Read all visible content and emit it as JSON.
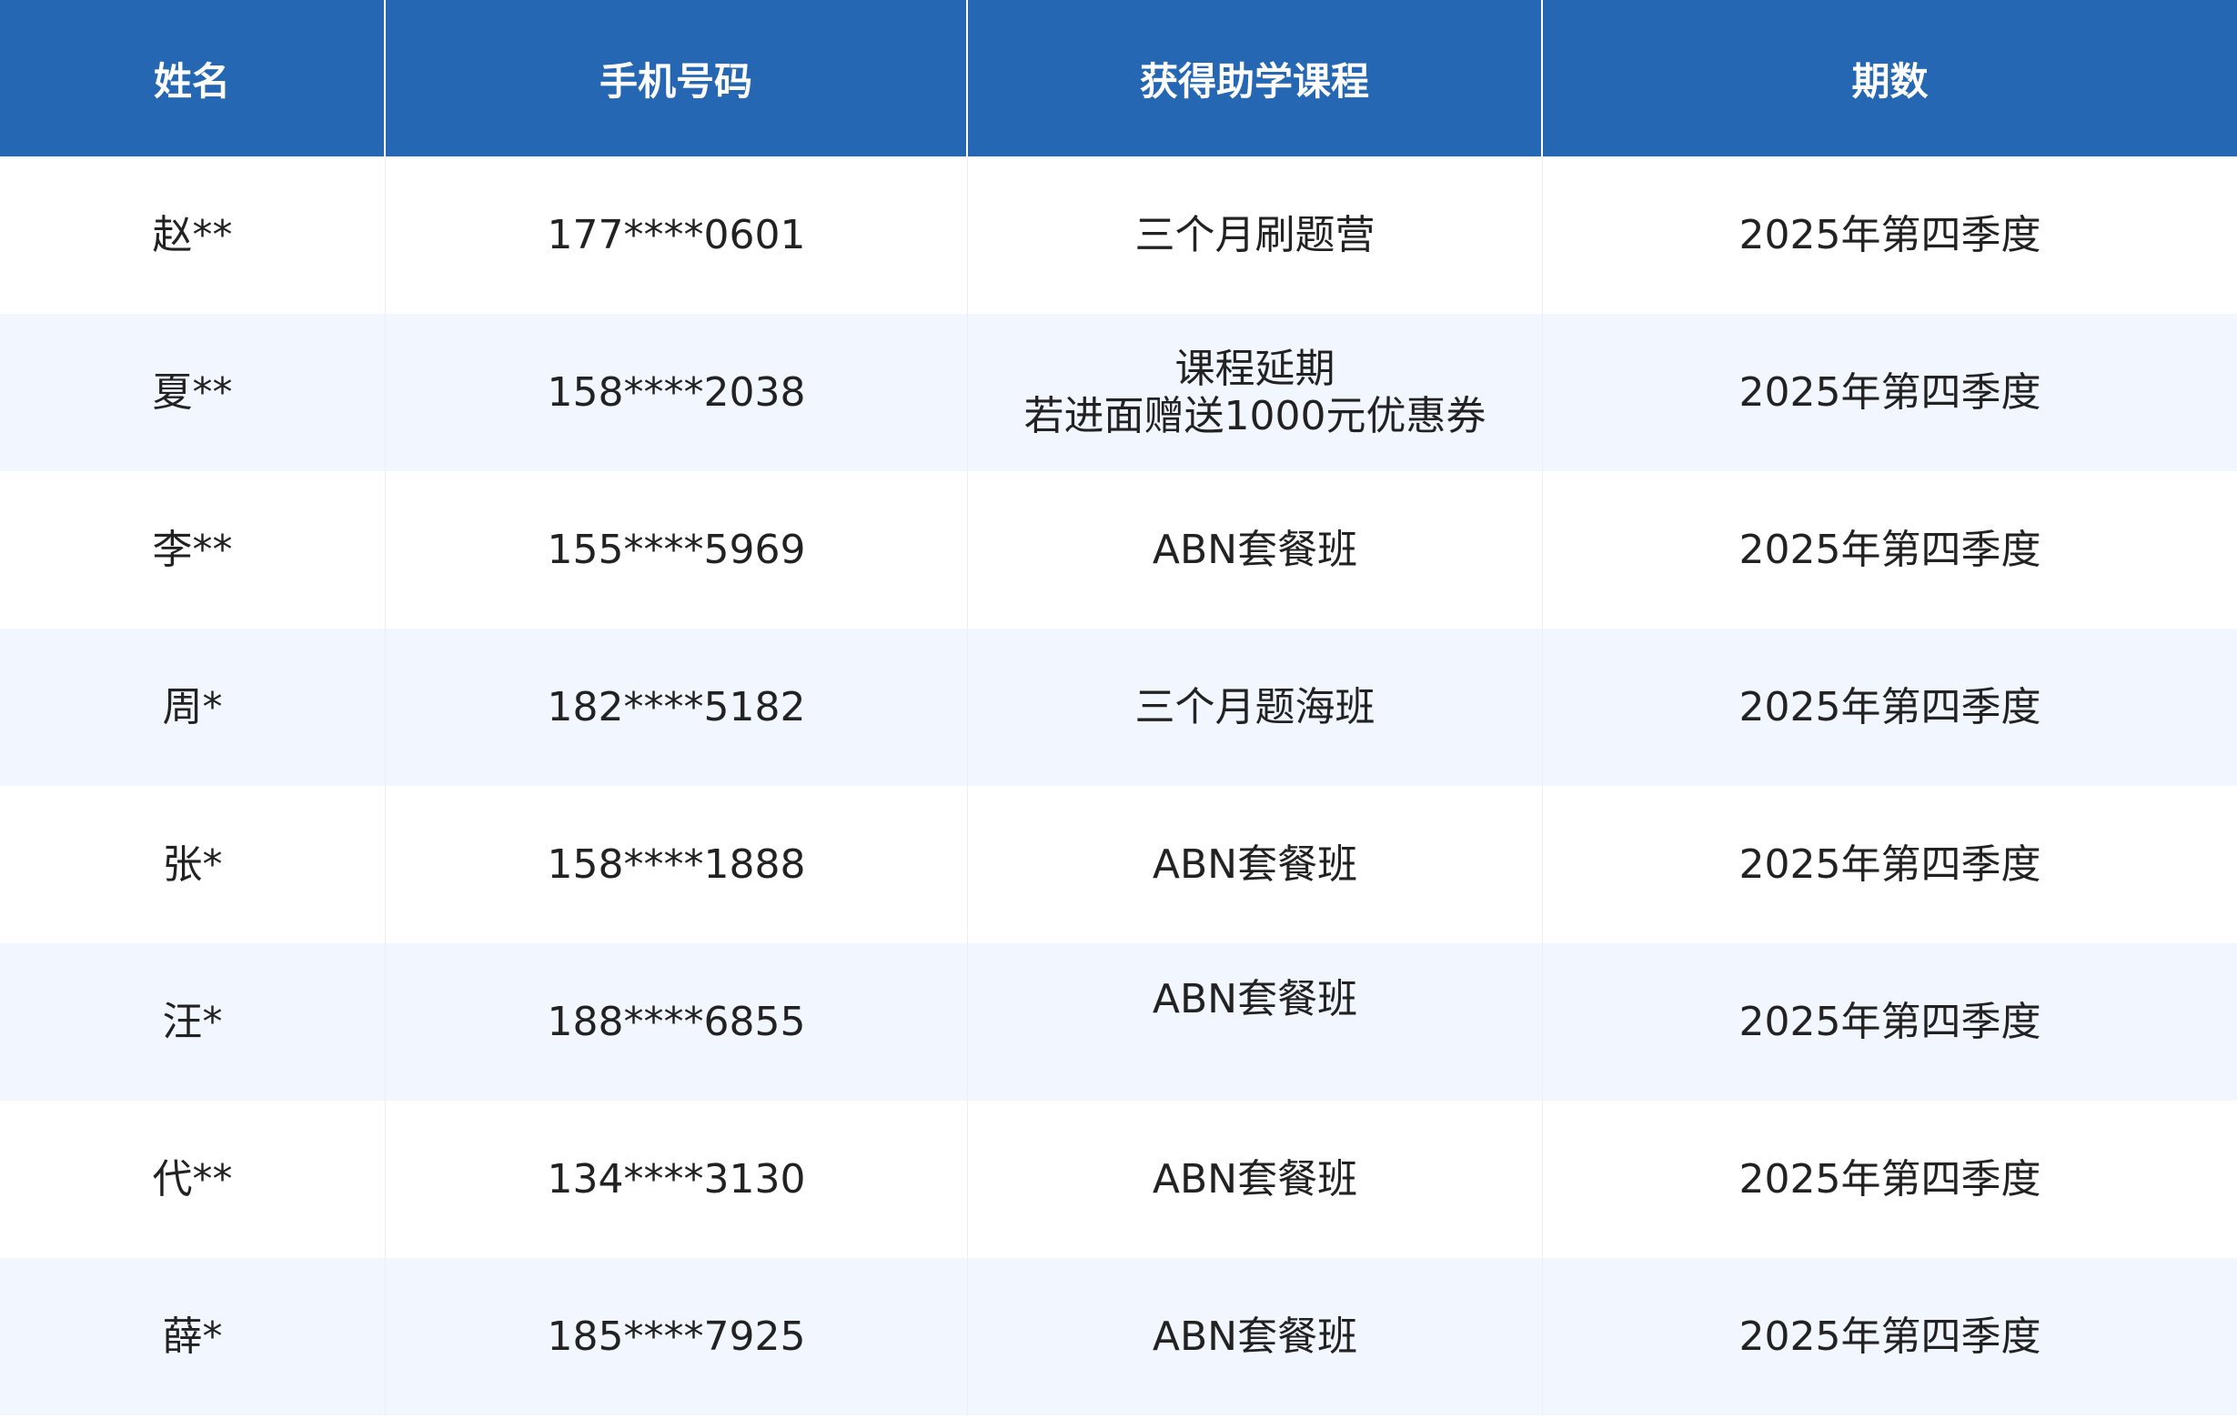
{
  "table": {
    "headers": [
      "姓名",
      "手机号码",
      "获得助学课程",
      "期数"
    ],
    "rows": [
      {
        "name": "赵**",
        "phone": "177****0601",
        "course_line1": "三个月刷题营",
        "course_line2": "",
        "period": "2025年第四季度"
      },
      {
        "name": "夏**",
        "phone": "158****2038",
        "course_line1": "课程延期",
        "course_line2": "若进面赠送1000元优惠券",
        "period": "2025年第四季度"
      },
      {
        "name": "李**",
        "phone": "155****5969",
        "course_line1": "ABN套餐班",
        "course_line2": "",
        "period": "2025年第四季度"
      },
      {
        "name": "周*",
        "phone": "182****5182",
        "course_line1": "三个月题海班",
        "course_line2": "",
        "period": "2025年第四季度"
      },
      {
        "name": "张*",
        "phone": "158****1888",
        "course_line1": "ABN套餐班",
        "course_line2": "",
        "period": "2025年第四季度"
      },
      {
        "name": "汪*",
        "phone": "188****6855",
        "course_line1": "ABN套餐班",
        "course_line2": "",
        "period": "2025年第四季度"
      },
      {
        "name": "代**",
        "phone": "134****3130",
        "course_line1": "ABN套餐班",
        "course_line2": "",
        "period": "2025年第四季度"
      },
      {
        "name": "薛*",
        "phone": "185****7925",
        "course_line1": "ABN套餐班",
        "course_line2": "",
        "period": "2025年第四季度"
      }
    ]
  },
  "colors": {
    "header_bg": "#2567b3",
    "header_text": "#ffffff",
    "alt_row_bg": "#f2f6fe",
    "text": "#222222"
  }
}
